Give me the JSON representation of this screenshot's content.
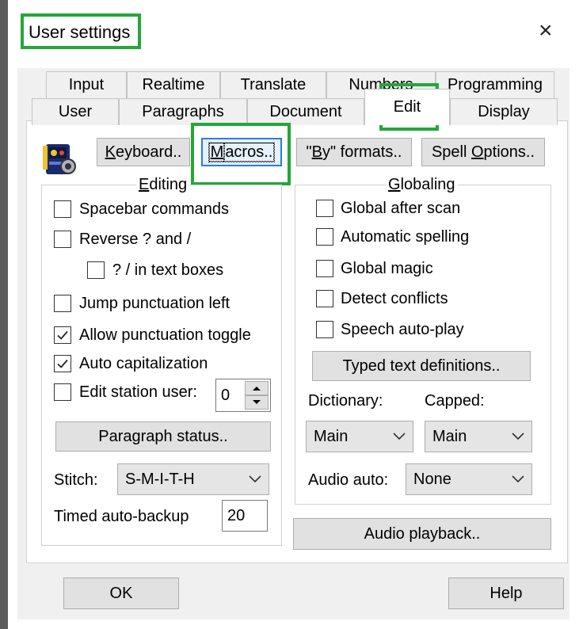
{
  "window": {
    "title": "User settings",
    "close_glyph": "×"
  },
  "tabs_row1": [
    "Input",
    "Realtime",
    "Translate",
    "Numbers",
    "Programming"
  ],
  "tabs_row2": [
    "User",
    "Paragraphs",
    "Document",
    "Edit",
    "Display"
  ],
  "active_tab": "Edit",
  "top_buttons": {
    "keyboard": {
      "u": "K",
      "rest": "eyboard.."
    },
    "macros": {
      "u": "M",
      "rest": "acros.."
    },
    "by_formats": {
      "pre": "\"",
      "u": "B",
      "rest": "y\" formats.."
    },
    "spell_options": {
      "pre": "Spell ",
      "u": "O",
      "rest": "ptions.."
    }
  },
  "editing": {
    "title": "Editing",
    "spacebar_commands": "Spacebar commands",
    "reverse": "Reverse ? and /",
    "in_text_boxes": "? / in text boxes",
    "jump_punct": "Jump punctuation left",
    "allow_punct": "Allow punctuation toggle",
    "auto_cap": "Auto capitalization",
    "edit_station_user": "Edit station user:",
    "station_value": "0",
    "paragraph_status": "Paragraph status..",
    "stitch_label": "Stitch:",
    "stitch_value": "S-M-I-T-H",
    "timed_label": "Timed auto-backup",
    "timed_value": "20"
  },
  "checks": {
    "spacebar_commands": false,
    "reverse": false,
    "in_text_boxes": false,
    "jump_punct": false,
    "allow_punct": true,
    "auto_cap": true,
    "edit_station_user": false,
    "global_after_scan": false,
    "automatic_spelling": false,
    "global_magic": false,
    "detect_conflicts": false,
    "speech_auto_play": false
  },
  "globaling": {
    "title": "Globaling",
    "global_after_scan": "Global after scan",
    "automatic_spelling": "Automatic spelling",
    "global_magic": "Global magic",
    "detect_conflicts": "Detect conflicts",
    "speech_auto_play": "Speech auto-play",
    "typed_text": "Typed text definitions..",
    "dictionary_label": "Dictionary:",
    "capped_label": "Capped:",
    "dictionary_value": "Main",
    "capped_value": "Main",
    "audio_auto_label": "Audio auto:",
    "audio_auto_value": "None"
  },
  "audio_playback": "Audio playback..",
  "footer": {
    "ok": "OK",
    "help": "Help"
  },
  "colors": {
    "highlight": "#23a73a",
    "focus": "#2a7be6"
  },
  "icons": [
    "app-icon",
    "close-icon",
    "checkmark-icon",
    "chevron-down-icon",
    "spin-up-icon",
    "spin-down-icon"
  ]
}
